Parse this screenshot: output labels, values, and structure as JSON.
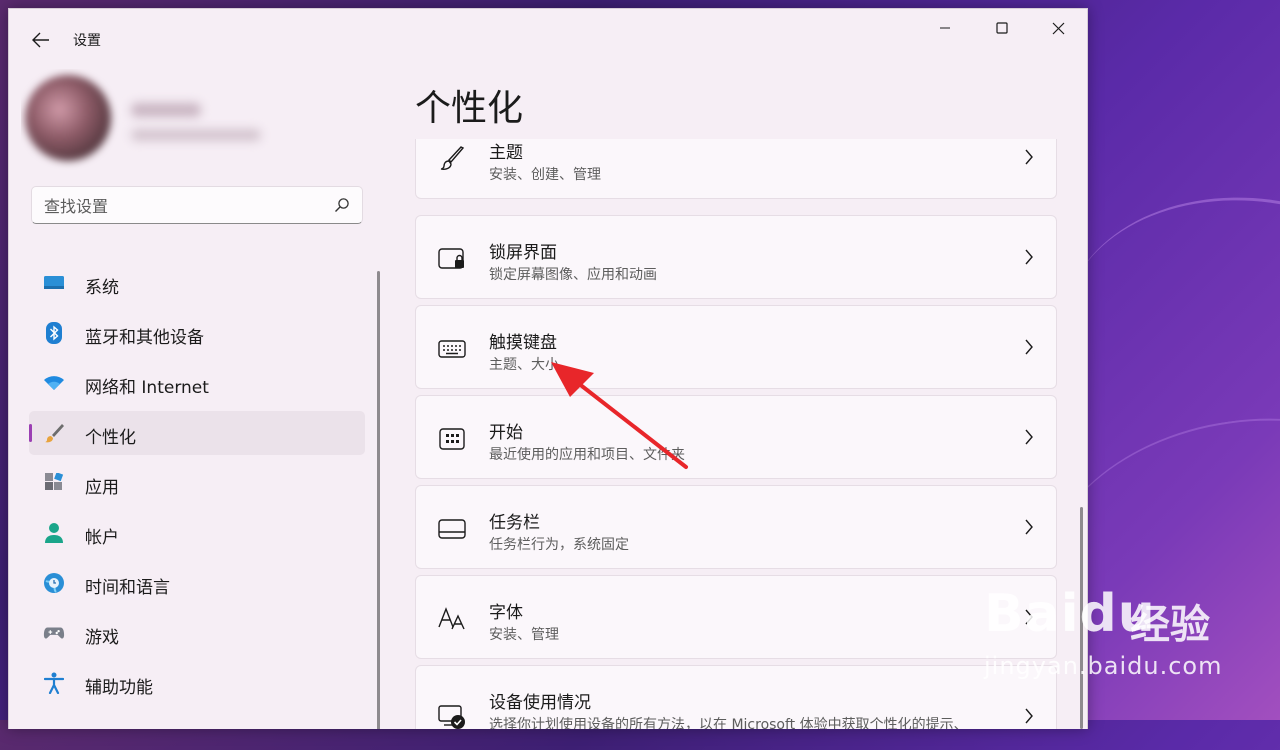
{
  "window": {
    "title": "设置"
  },
  "search": {
    "placeholder": "查找设置"
  },
  "sidebar": {
    "items": [
      {
        "label": "系统",
        "icon": "monitor-icon"
      },
      {
        "label": "蓝牙和其他设备",
        "icon": "bluetooth-icon"
      },
      {
        "label": "网络和 Internet",
        "icon": "wifi-icon"
      },
      {
        "label": "个性化",
        "icon": "brush-icon",
        "active": true
      },
      {
        "label": "应用",
        "icon": "apps-icon"
      },
      {
        "label": "帐户",
        "icon": "person-icon"
      },
      {
        "label": "时间和语言",
        "icon": "globe-clock-icon"
      },
      {
        "label": "游戏",
        "icon": "gamepad-icon"
      },
      {
        "label": "辅助功能",
        "icon": "accessibility-icon"
      }
    ]
  },
  "main": {
    "title": "个性化",
    "cards": [
      {
        "title": "主题",
        "desc": "安装、创建、管理",
        "icon": "paintbrush-icon"
      },
      {
        "title": "锁屏界面",
        "desc": "锁定屏幕图像、应用和动画",
        "icon": "lock-screen-icon"
      },
      {
        "title": "触摸键盘",
        "desc": "主题、大小",
        "icon": "keyboard-icon"
      },
      {
        "title": "开始",
        "desc": "最近使用的应用和项目、文件夹",
        "icon": "start-menu-icon"
      },
      {
        "title": "任务栏",
        "desc": "任务栏行为，系统固定",
        "icon": "taskbar-icon"
      },
      {
        "title": "字体",
        "desc": "安装、管理",
        "icon": "font-icon"
      },
      {
        "title": "设备使用情况",
        "desc": "选择你计划使用设备的所有方法，以在 Microsoft 体验中获取个性化的提示、",
        "icon": "device-usage-icon"
      }
    ]
  },
  "colors": {
    "accent": "#9b3fb3",
    "annotation_arrow": "#e8262a"
  },
  "watermark": {
    "logo": "Baidu",
    "suffix": "经验",
    "url": "jingyan.baidu.com"
  }
}
